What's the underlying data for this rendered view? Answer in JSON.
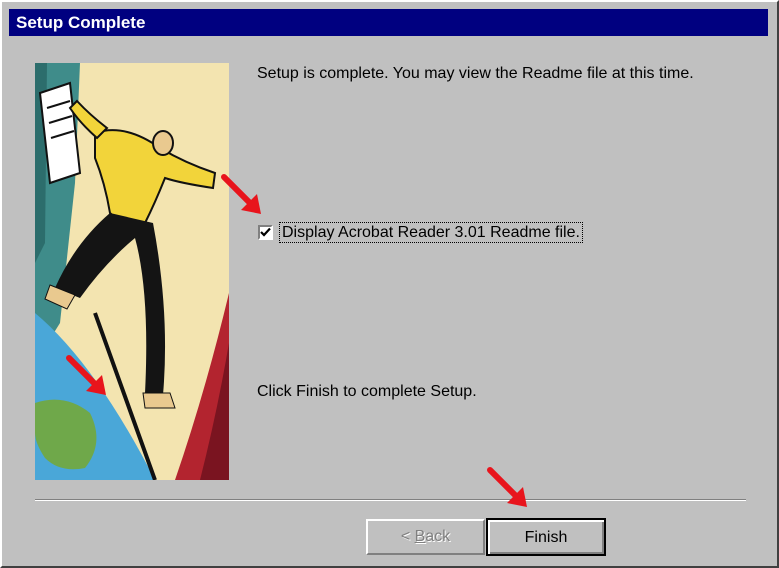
{
  "window": {
    "title": "Setup Complete"
  },
  "main": {
    "intro_text": "Setup is complete.  You may view the Readme file at this time.",
    "checkbox": {
      "label": "Display Acrobat Reader 3.01 Readme file.",
      "checked": true
    },
    "finish_text": "Click Finish to complete Setup."
  },
  "buttons": {
    "back": {
      "prefix": "< ",
      "accel": "B",
      "rest": "ack",
      "enabled": false
    },
    "finish": {
      "label": "Finish",
      "enabled": true,
      "default": true
    }
  },
  "colors": {
    "titlebar": "#000080",
    "face": "#c0c0c0",
    "annotation_arrow": "#e8141c"
  },
  "icons": {
    "illustration": "jumping-man-illustration",
    "annotation": "red-arrow-icon"
  }
}
